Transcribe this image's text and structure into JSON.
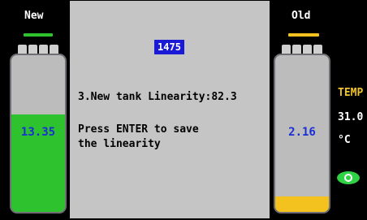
{
  "new_tank": {
    "title": "New",
    "value": "13.35",
    "fill_level": 0.62,
    "fill_color": "#2ec22e",
    "indicator_color": "#2ec22e"
  },
  "old_tank": {
    "title": "Old",
    "value": "2.16",
    "fill_level": 0.1,
    "fill_color": "#f4c21f",
    "indicator_color": "#f4c21f"
  },
  "panel": {
    "counter": "1475",
    "linearity_line": "3.New tank Linearity:82.3",
    "prompt_line1": "Press ENTER to save",
    "prompt_line2": "the linearity"
  },
  "temp": {
    "label": "TEMP",
    "value": "31.0",
    "unit": "°C"
  },
  "icons": {
    "status": "eye-icon"
  }
}
